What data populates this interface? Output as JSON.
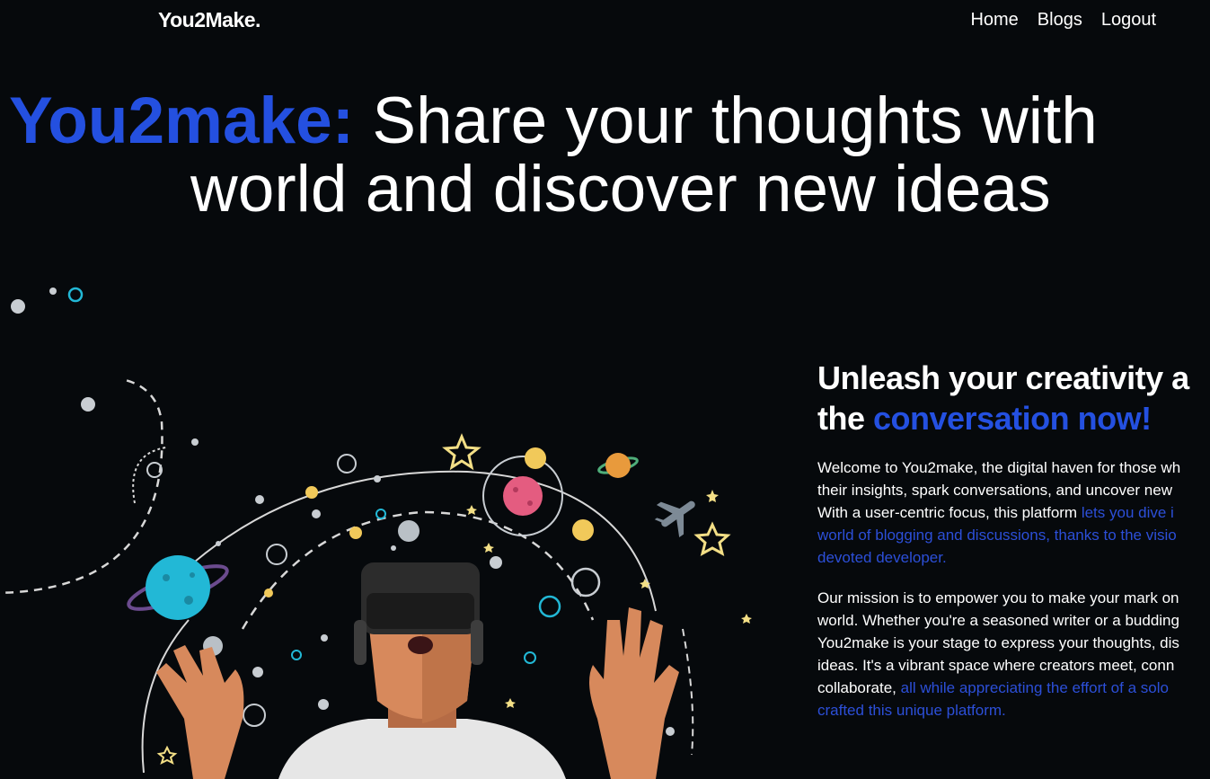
{
  "nav": {
    "brand": "You2Make.",
    "links": [
      "Home",
      "Blogs",
      "Logout"
    ]
  },
  "hero": {
    "accent": "You2make:",
    "line1": "Share your thoughts with",
    "line2": "world and discover new ideas"
  },
  "section": {
    "heading_line1": "Unleash your creativity a",
    "heading_line2_prefix": "the",
    "heading_line2_accent": "conversation now!",
    "p1": {
      "line1": "Welcome to You2make, the digital haven for those wh",
      "line2": "their insights, spark conversations, and uncover new",
      "line3_text": "With a user-centric focus, this platform",
      "line3_link": "lets you dive i",
      "line4_link": "world of blogging and discussions, thanks to the visio",
      "line5_link": "devoted developer."
    },
    "p2": {
      "line1": "Our mission is to empower you to make your mark on",
      "line2": "world. Whether you're a seasoned writer or a budding",
      "line3": "You2make is your stage to express your thoughts, dis",
      "line4": "ideas. It's a vibrant space where creators meet, conn",
      "line5_text": "collaborate,",
      "line5_link": "all while appreciating the effort of a solo",
      "line6_link": "crafted this unique platform."
    }
  },
  "colors": {
    "background": "#06090c",
    "accent": "#2450e0",
    "link": "#2c4fd8",
    "planet_blue": "#22b8d6",
    "planet_pink": "#e45c80",
    "star_yellow": "#f3df86"
  }
}
